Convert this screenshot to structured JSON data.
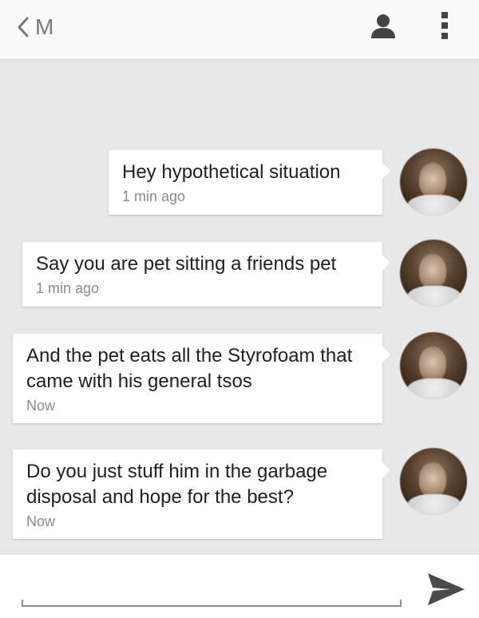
{
  "header": {
    "title": "M",
    "back_icon": "chevron-left-icon",
    "contact_icon": "person-icon",
    "menu_icon": "more-vert-icon"
  },
  "messages": [
    {
      "text": "Hey hypothetical situation",
      "time": "1 min ago"
    },
    {
      "text": "Say you are pet sitting a friends pet",
      "time": "1 min ago"
    },
    {
      "text": "And the pet eats all the Styrofoam that came with his general tsos",
      "time": "Now"
    },
    {
      "text": "Do you just stuff him in the garbage disposal and hope for the best?",
      "time": "Now"
    }
  ],
  "composer": {
    "value": "",
    "placeholder": "",
    "send_icon": "send-icon"
  },
  "colors": {
    "chat_background": "#e8e8e8",
    "bubble": "#ffffff",
    "icon": "#444444",
    "muted": "#8a8a8a"
  }
}
